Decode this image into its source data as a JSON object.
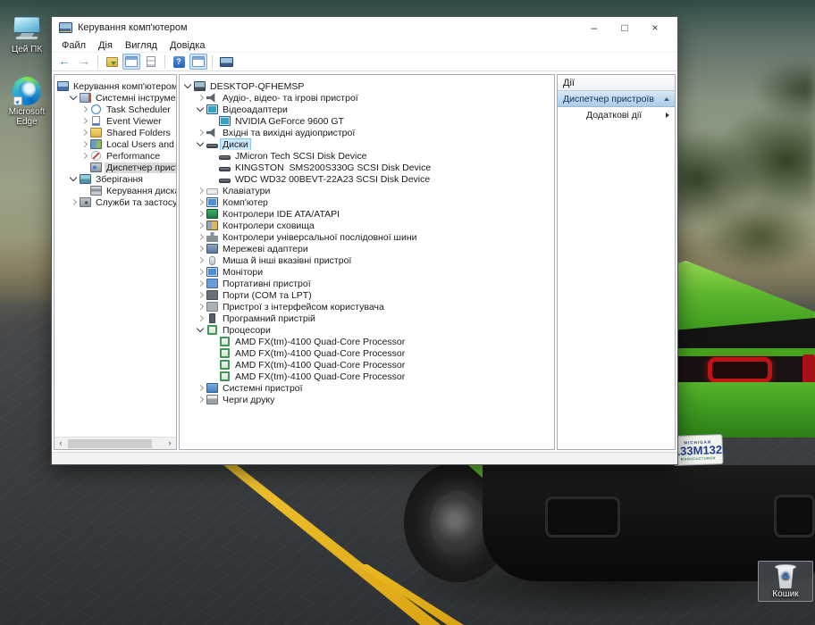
{
  "desktop": {
    "colors": {
      "car_green": "#4fae24",
      "road": "#3c3f41",
      "line_yellow": "#e2ac1e",
      "sky_blur": "#8a947f"
    },
    "icons": [
      {
        "name": "this-pc",
        "label": "Цей ПК"
      },
      {
        "name": "microsoft-edge",
        "label": "Microsoft Edge"
      },
      {
        "name": "recycle-bin",
        "label": "Кошик"
      }
    ],
    "license_plate": {
      "state": "MICHIGAN",
      "number": "133M132",
      "caption": "MANUFACTURER"
    }
  },
  "window": {
    "title": "Керування комп'ютером",
    "controls": {
      "minimize": "–",
      "maximize": "□",
      "close": "×"
    },
    "menu": [
      "Файл",
      "Дія",
      "Вигляд",
      "Довідка"
    ],
    "toolbar": [
      {
        "name": "back-icon"
      },
      {
        "name": "forward-icon"
      },
      {
        "name": "separator"
      },
      {
        "name": "export-list-icon"
      },
      {
        "name": "show-console-tree-icon",
        "toggled": true
      },
      {
        "name": "properties-icon"
      },
      {
        "name": "separator"
      },
      {
        "name": "help-icon"
      },
      {
        "name": "show-action-pane-icon",
        "toggled": true
      },
      {
        "name": "separator"
      },
      {
        "name": "remote-computer-icon"
      }
    ],
    "console_tree": {
      "items": [
        {
          "level": 0,
          "expander": "",
          "icon": "computer-management-icon",
          "label": "Керування комп'ютером (лок"
        },
        {
          "level": 1,
          "expander": "v",
          "icon": "system-tools-icon",
          "label": "Системні інструменти"
        },
        {
          "level": 2,
          "expander": ">",
          "icon": "task-scheduler-icon",
          "label": "Task Scheduler"
        },
        {
          "level": 2,
          "expander": ">",
          "icon": "event-viewer-icon",
          "label": "Event Viewer"
        },
        {
          "level": 2,
          "expander": ">",
          "icon": "shared-folders-icon",
          "label": "Shared Folders"
        },
        {
          "level": 2,
          "expander": ">",
          "icon": "local-users-icon",
          "label": "Local Users and Groups"
        },
        {
          "level": 2,
          "expander": ">",
          "icon": "performance-icon",
          "label": "Performance"
        },
        {
          "level": 2,
          "expander": "",
          "icon": "device-manager-icon",
          "label": "Диспетчер пристроїв",
          "selected": "inactive"
        },
        {
          "level": 1,
          "expander": "v",
          "icon": "storage-icon",
          "label": "Зберігання"
        },
        {
          "level": 2,
          "expander": "",
          "icon": "disk-management-icon",
          "label": "Керування дисками"
        },
        {
          "level": 1,
          "expander": ">",
          "icon": "services-icon",
          "label": "Служби та застосунки"
        }
      ]
    },
    "device_tree": {
      "items": [
        {
          "level": 0,
          "expander": "v",
          "icon": "computer-icon",
          "label": "DESKTOP-QFHEMSP"
        },
        {
          "level": 1,
          "expander": ">",
          "icon": "audio-icon",
          "label": "Аудіо-, відео- та ігрові пристрої"
        },
        {
          "level": 1,
          "expander": "v",
          "icon": "display-adapter-icon",
          "label": "Відеоадаптери"
        },
        {
          "level": 2,
          "expander": "",
          "icon": "display-adapter-icon",
          "label": "NVIDIA GeForce 9600 GT"
        },
        {
          "level": 1,
          "expander": ">",
          "icon": "audio-icon",
          "label": "Вхідні та вихідні аудіопристрої"
        },
        {
          "level": 1,
          "expander": "v",
          "icon": "disk-icon",
          "label": "Диски",
          "selected": "active"
        },
        {
          "level": 2,
          "expander": "",
          "icon": "disk-icon",
          "label": "JMicron Tech SCSI Disk Device"
        },
        {
          "level": 2,
          "expander": "",
          "icon": "disk-icon",
          "label": "KINGSTON  SMS200S330G SCSI Disk Device"
        },
        {
          "level": 2,
          "expander": "",
          "icon": "disk-icon",
          "label": "WDC WD32 00BEVT-22A23 SCSI Disk Device"
        },
        {
          "level": 1,
          "expander": ">",
          "icon": "keyboard-icon",
          "label": "Клавіатури"
        },
        {
          "level": 1,
          "expander": ">",
          "icon": "computer-monitor-icon",
          "label": "Комп'ютер"
        },
        {
          "level": 1,
          "expander": ">",
          "icon": "ide-controller-icon",
          "label": "Контролери IDE ATA/ATAPI"
        },
        {
          "level": 1,
          "expander": ">",
          "icon": "storage-controller-icon",
          "label": "Контролери сховища"
        },
        {
          "level": 1,
          "expander": ">",
          "icon": "usb-icon",
          "label": "Контролери універсальної послідовної шини"
        },
        {
          "level": 1,
          "expander": ">",
          "icon": "network-adapter-icon",
          "label": "Мережеві адаптери"
        },
        {
          "level": 1,
          "expander": ">",
          "icon": "mouse-icon",
          "label": "Миша й інші вказівні пристрої"
        },
        {
          "level": 1,
          "expander": ">",
          "icon": "monitor-icon",
          "label": "Монітори"
        },
        {
          "level": 1,
          "expander": ">",
          "icon": "portable-device-icon",
          "label": "Портативні пристрої"
        },
        {
          "level": 1,
          "expander": ">",
          "icon": "ports-icon",
          "label": "Порти (COM та LPT)"
        },
        {
          "level": 1,
          "expander": ">",
          "icon": "hid-icon",
          "label": "Пристрої з інтерфейсом користувача"
        },
        {
          "level": 1,
          "expander": ">",
          "icon": "software-device-icon",
          "label": "Програмний пристрій"
        },
        {
          "level": 1,
          "expander": "v",
          "icon": "processor-icon",
          "label": "Процесори"
        },
        {
          "level": 2,
          "expander": "",
          "icon": "processor-icon",
          "label": "AMD FX(tm)-4100 Quad-Core Processor"
        },
        {
          "level": 2,
          "expander": "",
          "icon": "processor-icon",
          "label": "AMD FX(tm)-4100 Quad-Core Processor"
        },
        {
          "level": 2,
          "expander": "",
          "icon": "processor-icon",
          "label": "AMD FX(tm)-4100 Quad-Core Processor"
        },
        {
          "level": 2,
          "expander": "",
          "icon": "processor-icon",
          "label": "AMD FX(tm)-4100 Quad-Core Processor"
        },
        {
          "level": 1,
          "expander": ">",
          "icon": "system-devices-icon",
          "label": "Системні пристрої"
        },
        {
          "level": 1,
          "expander": ">",
          "icon": "print-queue-icon",
          "label": "Черги друку"
        }
      ]
    },
    "actions_pane": {
      "header": "Дії",
      "group_title": "Диспетчер пристроїв",
      "items": [
        {
          "label": "Додаткові дії"
        }
      ]
    }
  }
}
